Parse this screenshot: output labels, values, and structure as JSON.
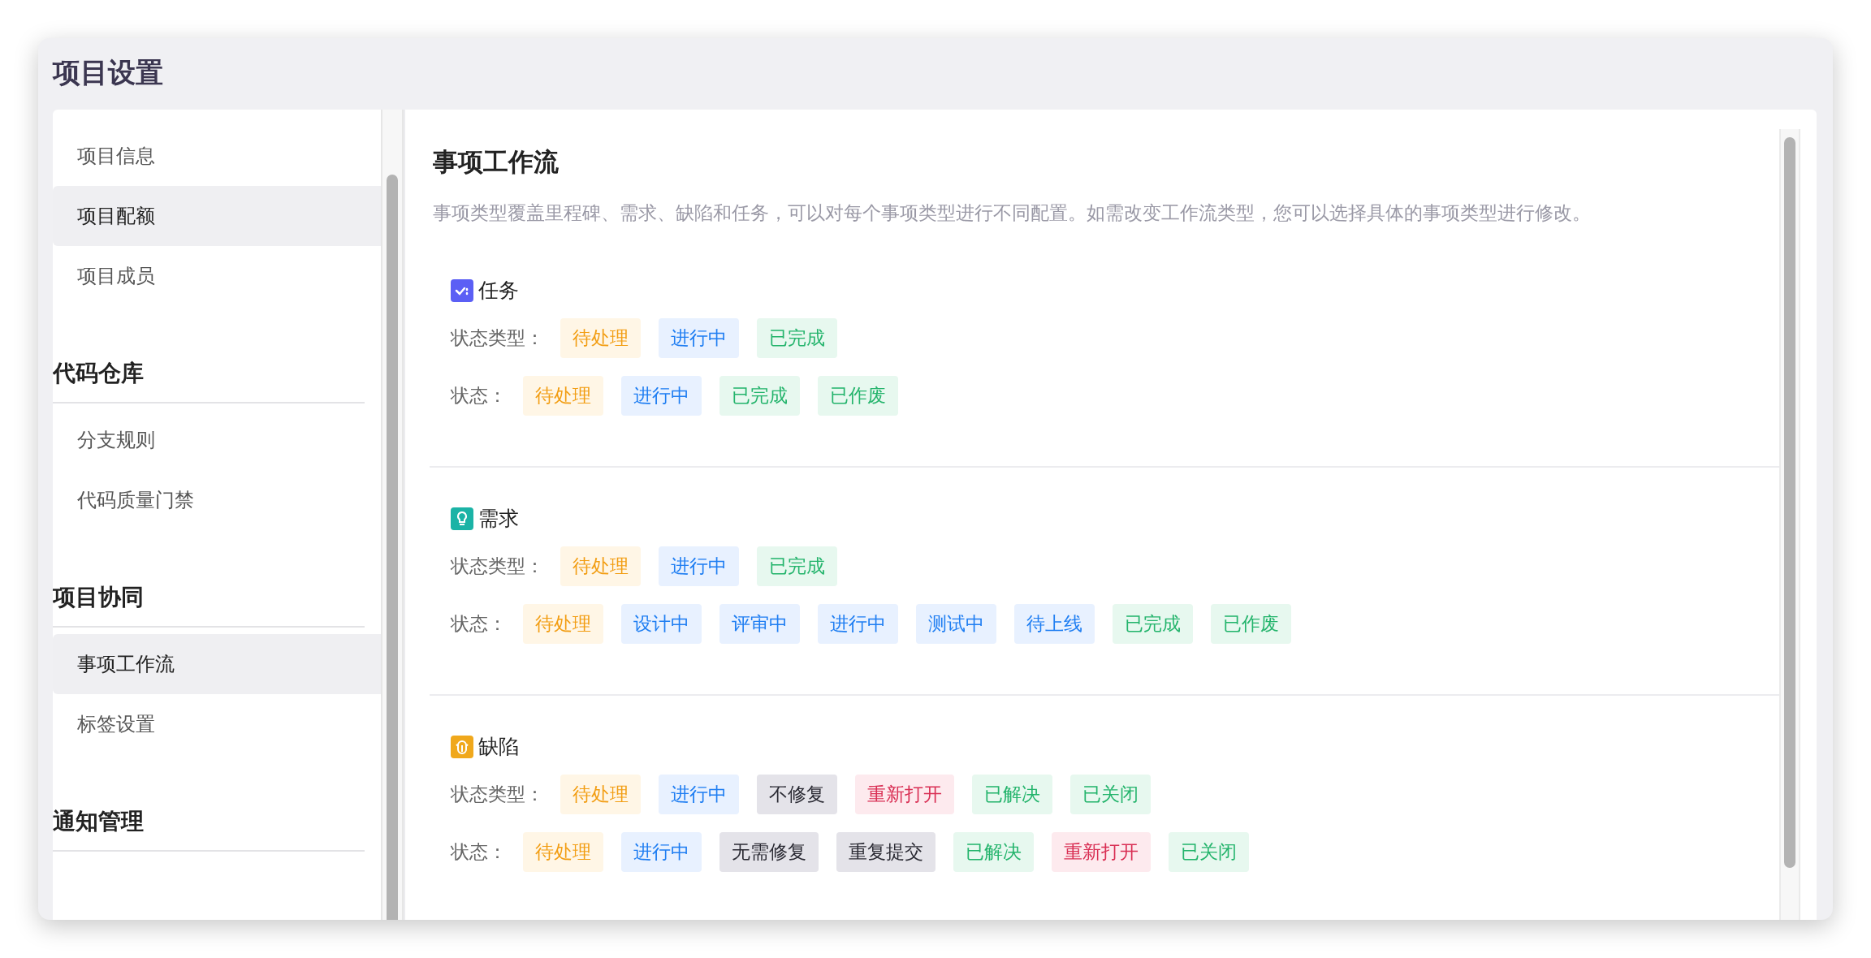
{
  "window": {
    "title": "项目设置"
  },
  "sidebar": {
    "groups": [
      {
        "items": [
          {
            "label": "项目信息",
            "selected": false
          },
          {
            "label": "项目配额",
            "selected": true
          },
          {
            "label": "项目成员",
            "selected": false
          }
        ]
      },
      {
        "title": "代码仓库",
        "items": [
          {
            "label": "分支规则",
            "selected": false
          },
          {
            "label": "代码质量门禁",
            "selected": false
          }
        ]
      },
      {
        "title": "项目协同",
        "items": [
          {
            "label": "事项工作流",
            "selected": true
          },
          {
            "label": "标签设置",
            "selected": false
          }
        ]
      },
      {
        "title": "通知管理"
      }
    ]
  },
  "content": {
    "title": "事项工作流",
    "description": "事项类型覆盖里程碑、需求、缺陷和任务，可以对每个事项类型进行不同配置。如需改变工作流类型，您可以选择具体的事项类型进行修改。",
    "sections": [
      {
        "kind": "task",
        "name": "任务",
        "rows": [
          {
            "label": "状态类型：",
            "tags": [
              {
                "text": "待处理",
                "kind": "pending"
              },
              {
                "text": "进行中",
                "kind": "active"
              },
              {
                "text": "已完成",
                "kind": "done"
              }
            ]
          },
          {
            "label": "状态：",
            "tags": [
              {
                "text": "待处理",
                "kind": "pending"
              },
              {
                "text": "进行中",
                "kind": "active"
              },
              {
                "text": "已完成",
                "kind": "done"
              },
              {
                "text": "已作废",
                "kind": "done"
              }
            ]
          }
        ]
      },
      {
        "kind": "requirement",
        "name": "需求",
        "rows": [
          {
            "label": "状态类型：",
            "tags": [
              {
                "text": "待处理",
                "kind": "pending"
              },
              {
                "text": "进行中",
                "kind": "active"
              },
              {
                "text": "已完成",
                "kind": "done"
              }
            ]
          },
          {
            "label": "状态：",
            "tags": [
              {
                "text": "待处理",
                "kind": "pending"
              },
              {
                "text": "设计中",
                "kind": "active"
              },
              {
                "text": "评审中",
                "kind": "active"
              },
              {
                "text": "进行中",
                "kind": "active"
              },
              {
                "text": "测试中",
                "kind": "active"
              },
              {
                "text": "待上线",
                "kind": "active"
              },
              {
                "text": "已完成",
                "kind": "done"
              },
              {
                "text": "已作废",
                "kind": "done"
              }
            ]
          }
        ]
      },
      {
        "kind": "bug",
        "name": "缺陷",
        "rows": [
          {
            "label": "状态类型：",
            "tags": [
              {
                "text": "待处理",
                "kind": "pending"
              },
              {
                "text": "进行中",
                "kind": "active"
              },
              {
                "text": "不修复",
                "kind": "neutral"
              },
              {
                "text": "重新打开",
                "kind": "reopen"
              },
              {
                "text": "已解决",
                "kind": "done"
              },
              {
                "text": "已关闭",
                "kind": "done"
              }
            ]
          },
          {
            "label": "状态：",
            "tags": [
              {
                "text": "待处理",
                "kind": "pending"
              },
              {
                "text": "进行中",
                "kind": "active"
              },
              {
                "text": "无需修复",
                "kind": "neutral"
              },
              {
                "text": "重复提交",
                "kind": "neutral"
              },
              {
                "text": "已解决",
                "kind": "done"
              },
              {
                "text": "重新打开",
                "kind": "reopen"
              },
              {
                "text": "已关闭",
                "kind": "done"
              }
            ]
          }
        ]
      }
    ]
  }
}
